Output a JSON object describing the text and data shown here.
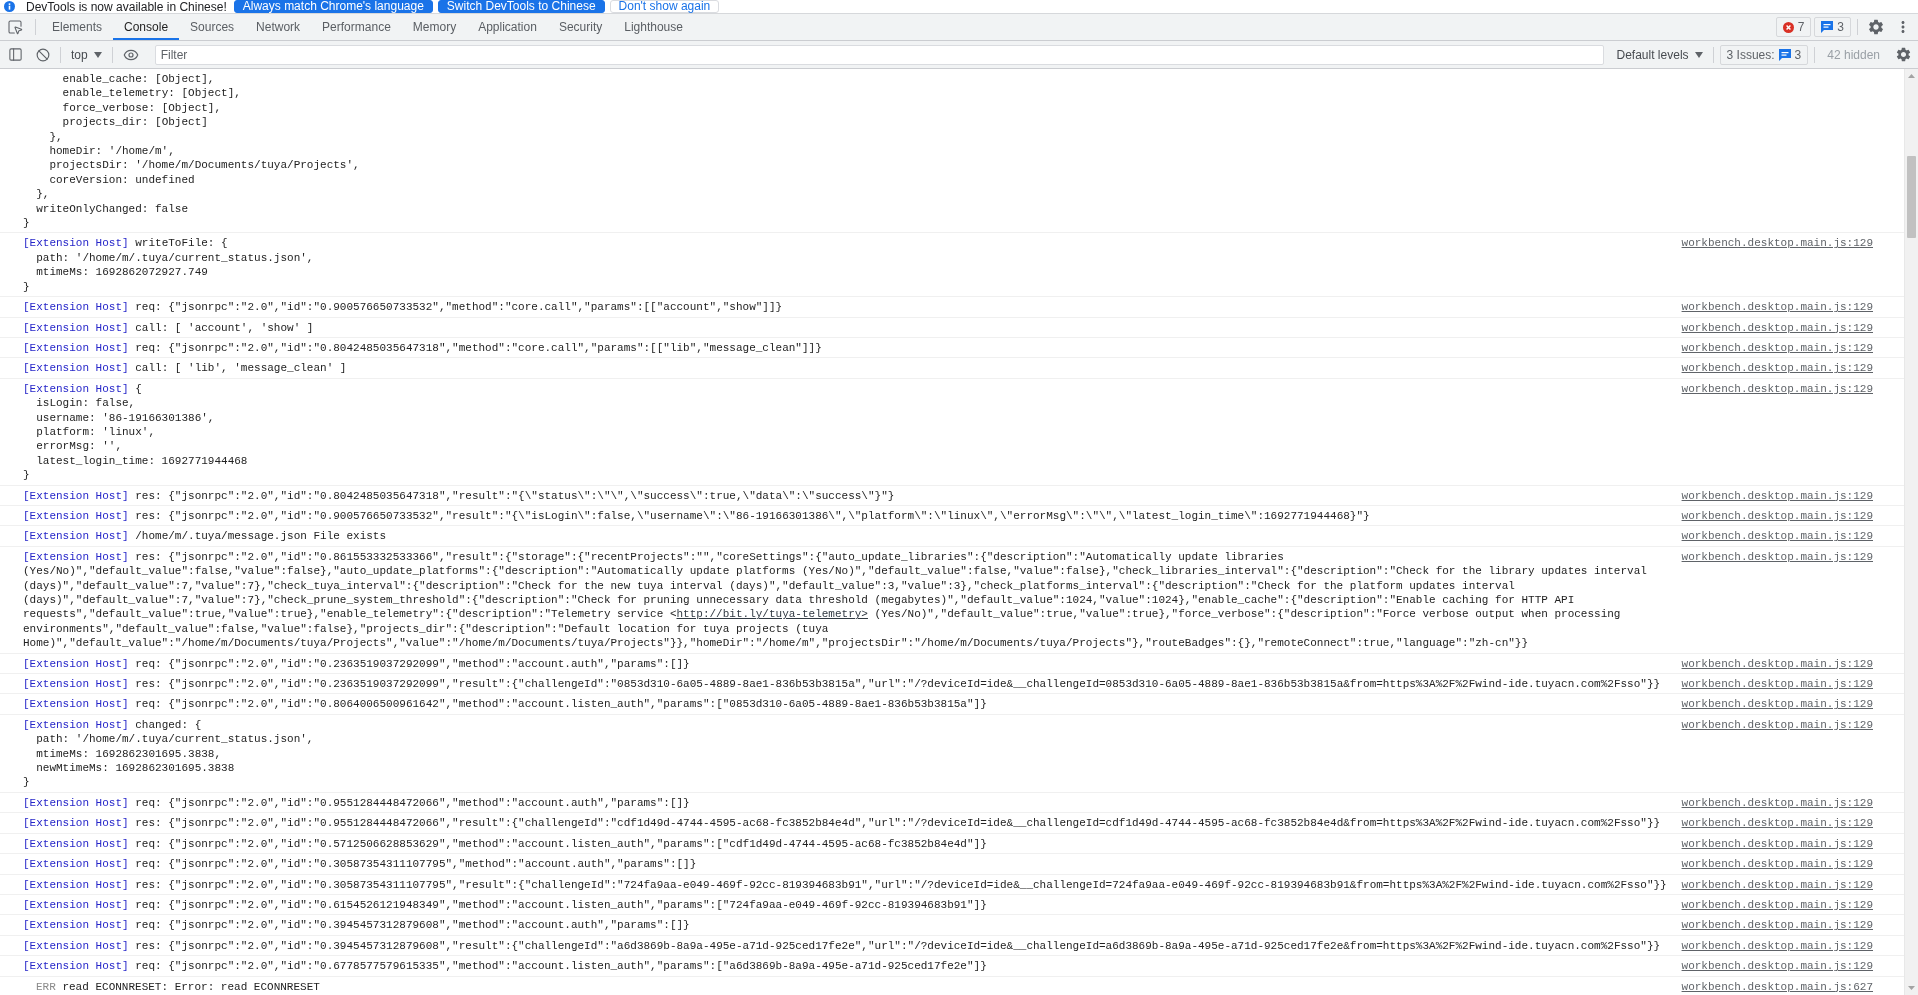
{
  "infobar": {
    "message": "DevTools is now available in Chinese!",
    "buttons": [
      {
        "label": "Always match Chrome's language",
        "kind": "primary"
      },
      {
        "label": "Switch DevTools to Chinese",
        "kind": "primary"
      },
      {
        "label": "Don't show again",
        "kind": "secondary"
      }
    ]
  },
  "tabs": [
    {
      "label": "Elements",
      "selected": false
    },
    {
      "label": "Console",
      "selected": true
    },
    {
      "label": "Sources",
      "selected": false
    },
    {
      "label": "Network",
      "selected": false
    },
    {
      "label": "Performance",
      "selected": false
    },
    {
      "label": "Memory",
      "selected": false
    },
    {
      "label": "Application",
      "selected": false
    },
    {
      "label": "Security",
      "selected": false
    },
    {
      "label": "Lighthouse",
      "selected": false
    }
  ],
  "status_badges": [
    {
      "kind": "error",
      "count": "7"
    },
    {
      "kind": "info",
      "count": "3"
    }
  ],
  "console_toolbar": {
    "context": "top",
    "filter_placeholder": "Filter",
    "levels": "Default levels",
    "issues_label": "3 Issues:",
    "issues_count": "3",
    "hidden": "42 hidden"
  },
  "messages": [
    {
      "kind": "continuation",
      "text": "      enable_cache: [Object],\n      enable_telemetry: [Object],\n      force_verbose: [Object],\n      projects_dir: [Object]\n    },\n    homeDir: '/home/m',\n    projectsDir: '/home/m/Documents/tuya/Projects',\n    coreVersion: undefined\n  },\n  writeOnlyChanged: false\n}"
    },
    {
      "kind": "log",
      "tag": "[Extension Host]",
      "text": "writeToFile: {\n  path: '/home/m/.tuya/current_status.json',\n  mtimeMs: 1692862072927.749\n}",
      "source": "workbench.desktop.main.js:129"
    },
    {
      "kind": "log",
      "tag": "[Extension Host]",
      "text": "req: {\"jsonrpc\":\"2.0\",\"id\":\"0.900576650733532\",\"method\":\"core.call\",\"params\":[[\"account\",\"show\"]]}",
      "source": "workbench.desktop.main.js:129"
    },
    {
      "kind": "log",
      "tag": "[Extension Host]",
      "text": "call: [ 'account', 'show' ]",
      "source": "workbench.desktop.main.js:129"
    },
    {
      "kind": "log",
      "tag": "[Extension Host]",
      "text": "req: {\"jsonrpc\":\"2.0\",\"id\":\"0.8042485035647318\",\"method\":\"core.call\",\"params\":[[\"lib\",\"message_clean\"]]}",
      "source": "workbench.desktop.main.js:129"
    },
    {
      "kind": "log",
      "tag": "[Extension Host]",
      "text": "call: [ 'lib', 'message_clean' ]",
      "source": "workbench.desktop.main.js:129"
    },
    {
      "kind": "log",
      "tag": "[Extension Host]",
      "text": "{\n  isLogin: false,\n  username: '86-19166301386',\n  platform: 'linux',\n  errorMsg: '',\n  latest_login_time: 1692771944468\n}",
      "source": "workbench.desktop.main.js:129"
    },
    {
      "kind": "log",
      "tag": "[Extension Host]",
      "text": "res: {\"jsonrpc\":\"2.0\",\"id\":\"0.8042485035647318\",\"result\":\"{\\\"status\\\":\\\"\\\",\\\"success\\\":true,\\\"data\\\":\\\"success\\\"}\"}",
      "source": "workbench.desktop.main.js:129"
    },
    {
      "kind": "log",
      "tag": "[Extension Host]",
      "text": "res: {\"jsonrpc\":\"2.0\",\"id\":\"0.900576650733532\",\"result\":\"{\\\"isLogin\\\":false,\\\"username\\\":\\\"86-19166301386\\\",\\\"platform\\\":\\\"linux\\\",\\\"errorMsg\\\":\\\"\\\",\\\"latest_login_time\\\":1692771944468}\"}",
      "source": "workbench.desktop.main.js:129"
    },
    {
      "kind": "log",
      "tag": "[Extension Host]",
      "text": "/home/m/.tuya/message.json File exists",
      "source": "workbench.desktop.main.js:129"
    },
    {
      "kind": "log",
      "tag": "[Extension Host]",
      "text": "res: {\"jsonrpc\":\"2.0\",\"id\":\"0.861553332533366\",\"result\":{\"storage\":{\"recentProjects\":\"\",\"coreSettings\":{\"auto_update_libraries\":{\"description\":\"Automatically update libraries (Yes/No)\",\"default_value\":false,\"value\":false},\"auto_update_platforms\":{\"description\":\"Automatically update platforms (Yes/No)\",\"default_value\":false,\"value\":false},\"check_libraries_interval\":{\"description\":\"Check for the library updates interval (days)\",\"default_value\":7,\"value\":7},\"check_tuya_interval\":{\"description\":\"Check for the new tuya interval (days)\",\"default_value\":3,\"value\":3},\"check_platforms_interval\":{\"description\":\"Check for the platform updates interval (days)\",\"default_value\":7,\"value\":7},\"check_prune_system_threshold\":{\"description\":\"Check for pruning unnecessary data threshold (megabytes)\",\"default_value\":1024,\"value\":1024},\"enable_cache\":{\"description\":\"Enable caching for HTTP API requests\",\"default_value\":true,\"value\":true},\"enable_telemetry\":{\"description\":\"Telemetry service <",
      "link": "http://bit.ly/tuya-telemetry>",
      "text_after": " (Yes/No)\",\"default_value\":true,\"value\":true},\"force_verbose\":{\"description\":\"Force verbose output when processing environments\",\"default_value\":false,\"value\":false},\"projects_dir\":{\"description\":\"Default location for tuya projects (tuya Home)\",\"default_value\":\"/home/m/Documents/tuya/Projects\",\"value\":\"/home/m/Documents/tuya/Projects\"}},\"homeDir\":\"/home/m\",\"projectsDir\":\"/home/m/Documents/tuya/Projects\"},\"routeBadges\":{},\"remoteConnect\":true,\"language\":\"zh-cn\"}}",
      "source": "workbench.desktop.main.js:129"
    },
    {
      "kind": "log",
      "tag": "[Extension Host]",
      "text": "req: {\"jsonrpc\":\"2.0\",\"id\":\"0.2363519037292099\",\"method\":\"account.auth\",\"params\":[]}",
      "source": "workbench.desktop.main.js:129"
    },
    {
      "kind": "log",
      "tag": "[Extension Host]",
      "text": "res: {\"jsonrpc\":\"2.0\",\"id\":\"0.2363519037292099\",\"result\":{\"challengeId\":\"0853d310-6a05-4889-8ae1-836b53b3815a\",\"url\":\"/?deviceId=ide&__challengeId=0853d310-6a05-4889-8ae1-836b53b3815a&from=https%3A%2F%2Fwind-ide.tuyacn.com%2Fsso\"}}",
      "source": "workbench.desktop.main.js:129"
    },
    {
      "kind": "log",
      "tag": "[Extension Host]",
      "text": "req: {\"jsonrpc\":\"2.0\",\"id\":\"0.8064006500961642\",\"method\":\"account.listen_auth\",\"params\":[\"0853d310-6a05-4889-8ae1-836b53b3815a\"]}",
      "source": "workbench.desktop.main.js:129"
    },
    {
      "kind": "log",
      "tag": "[Extension Host]",
      "text": "changed: {\n  path: '/home/m/.tuya/current_status.json',\n  mtimeMs: 1692862301695.3838,\n  newMtimeMs: 1692862301695.3838\n}",
      "source": "workbench.desktop.main.js:129"
    },
    {
      "kind": "log",
      "tag": "[Extension Host]",
      "text": "req: {\"jsonrpc\":\"2.0\",\"id\":\"0.9551284448472066\",\"method\":\"account.auth\",\"params\":[]}",
      "source": "workbench.desktop.main.js:129"
    },
    {
      "kind": "log",
      "tag": "[Extension Host]",
      "text": "res: {\"jsonrpc\":\"2.0\",\"id\":\"0.9551284448472066\",\"result\":{\"challengeId\":\"cdf1d49d-4744-4595-ac68-fc3852b84e4d\",\"url\":\"/?deviceId=ide&__challengeId=cdf1d49d-4744-4595-ac68-fc3852b84e4d&from=https%3A%2F%2Fwind-ide.tuyacn.com%2Fsso\"}}",
      "source": "workbench.desktop.main.js:129"
    },
    {
      "kind": "log",
      "tag": "[Extension Host]",
      "text": "req: {\"jsonrpc\":\"2.0\",\"id\":\"0.5712506628853629\",\"method\":\"account.listen_auth\",\"params\":[\"cdf1d49d-4744-4595-ac68-fc3852b84e4d\"]}",
      "source": "workbench.desktop.main.js:129"
    },
    {
      "kind": "log",
      "tag": "[Extension Host]",
      "text": "req: {\"jsonrpc\":\"2.0\",\"id\":\"0.30587354311107795\",\"method\":\"account.auth\",\"params\":[]}",
      "source": "workbench.desktop.main.js:129"
    },
    {
      "kind": "log",
      "tag": "[Extension Host]",
      "text": "res: {\"jsonrpc\":\"2.0\",\"id\":\"0.30587354311107795\",\"result\":{\"challengeId\":\"724fa9aa-e049-469f-92cc-819394683b91\",\"url\":\"/?deviceId=ide&__challengeId=724fa9aa-e049-469f-92cc-819394683b91&from=https%3A%2F%2Fwind-ide.tuyacn.com%2Fsso\"}}",
      "source": "workbench.desktop.main.js:129"
    },
    {
      "kind": "log",
      "tag": "[Extension Host]",
      "text": "req: {\"jsonrpc\":\"2.0\",\"id\":\"0.6154526121948349\",\"method\":\"account.listen_auth\",\"params\":[\"724fa9aa-e049-469f-92cc-819394683b91\"]}",
      "source": "workbench.desktop.main.js:129"
    },
    {
      "kind": "log",
      "tag": "[Extension Host]",
      "text": "req: {\"jsonrpc\":\"2.0\",\"id\":\"0.3945457312879608\",\"method\":\"account.auth\",\"params\":[]}",
      "source": "workbench.desktop.main.js:129"
    },
    {
      "kind": "log",
      "tag": "[Extension Host]",
      "text": "res: {\"jsonrpc\":\"2.0\",\"id\":\"0.3945457312879608\",\"result\":{\"challengeId\":\"a6d3869b-8a9a-495e-a71d-925ced17fe2e\",\"url\":\"/?deviceId=ide&__challengeId=a6d3869b-8a9a-495e-a71d-925ced17fe2e&from=https%3A%2F%2Fwind-ide.tuyacn.com%2Fsso\"}}",
      "source": "workbench.desktop.main.js:129"
    },
    {
      "kind": "log",
      "tag": "[Extension Host]",
      "text": "req: {\"jsonrpc\":\"2.0\",\"id\":\"0.6778577579615335\",\"method\":\"account.listen_auth\",\"params\":[\"a6d3869b-8a9a-495e-a71d-925ced17fe2e\"]}",
      "source": "workbench.desktop.main.js:129"
    },
    {
      "kind": "err",
      "label": "ERR",
      "text": "read ECONNRESET: Error: read ECONNRESET",
      "source": "workbench.desktop.main.js:627"
    }
  ]
}
